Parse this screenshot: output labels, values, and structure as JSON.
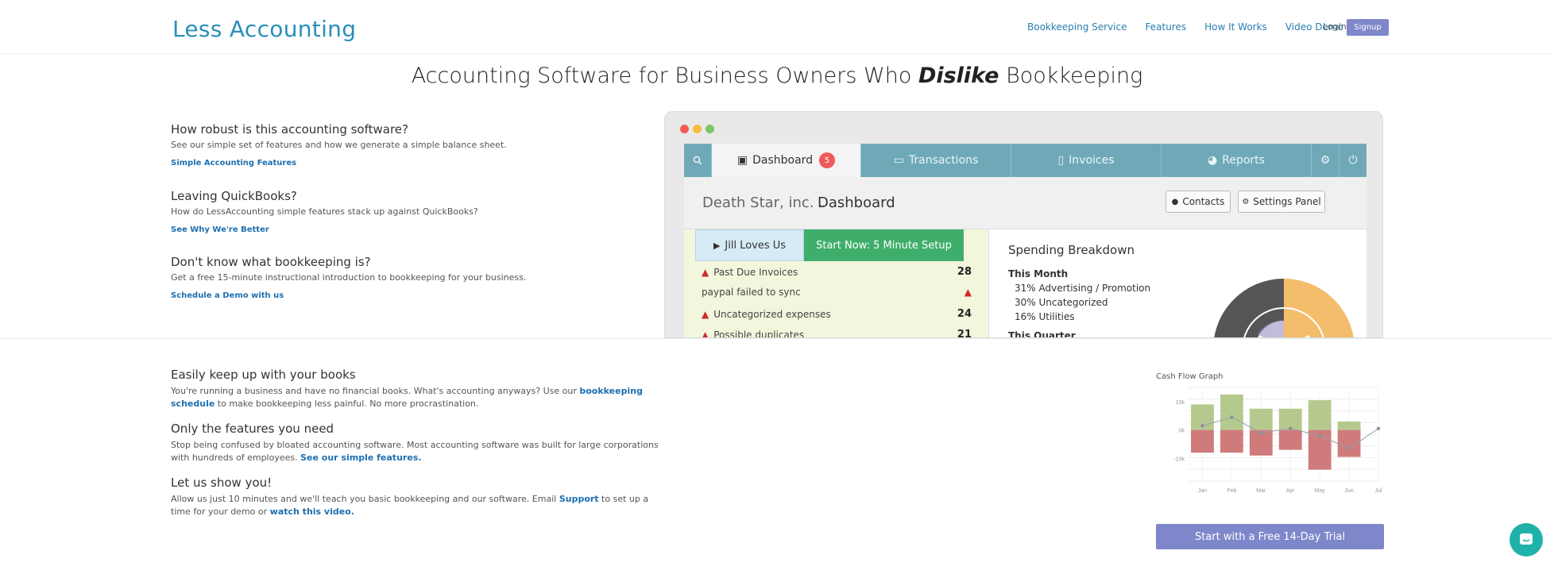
{
  "header": {
    "logo": "Less Accounting",
    "nav": [
      "Bookkeeping Service",
      "Features",
      "How It Works",
      "Video Demo"
    ],
    "login": "Login",
    "signup": "Signup"
  },
  "headline": {
    "before": "Accounting Software for Business Owners Who ",
    "emphasis": "Dislike",
    "after": " Bookkeeping"
  },
  "faq": [
    {
      "title": "How robust is this accounting software?",
      "text": "See our simple set of features and how we generate a simple balance sheet.",
      "link": "Simple Accounting Features"
    },
    {
      "title": "Leaving QuickBooks?",
      "text": "How do LessAccounting simple features stack up against QuickBooks?",
      "link": "See Why We're Better"
    },
    {
      "title": "Don't know what bookkeeping is?",
      "text": "Get a free 15-minute instructional introduction to bookkeeping for your business.",
      "link": "Schedule a Demo with us"
    }
  ],
  "app": {
    "tabs": {
      "dashboard": "Dashboard",
      "dashboard_badge": "5",
      "transactions": "Transactions",
      "invoices": "Invoices",
      "reports": "Reports"
    },
    "company": "Death Star, inc.",
    "page_title": "Dashboard",
    "contacts_btn": "Contacts",
    "settings_btn": "Settings Panel",
    "play_btn": "Jill Loves Us",
    "start_btn": "Start Now: 5 Minute Setup",
    "alerts": [
      {
        "label": "Past Due Invoices",
        "value": "28"
      },
      {
        "label": "paypal failed to sync",
        "value": ""
      },
      {
        "label": "Uncategorized expenses",
        "value": "24"
      },
      {
        "label": "Possible duplicates",
        "value": "21"
      }
    ],
    "spending_title": "Spending Breakdown",
    "this_month": "This Month",
    "spending": [
      "31% Advertising / Promotion",
      "30% Uncategorized",
      "16% Utilities"
    ],
    "this_quarter": "This Quarter"
  },
  "features": [
    {
      "title": "Easily keep up with your books",
      "text1": "You're running a business and have no financial books. What's accounting anyways? Use our ",
      "link": "bookkeeping schedule",
      "text2": " to make bookkeeping less painful. No more procrastination."
    },
    {
      "title": "Only the features you need",
      "text1": "Stop being confused by bloated accounting software. Most accounting software was built for large corporations with hundreds of employees. ",
      "link": "See our simple features.",
      "text2": ""
    },
    {
      "title": "Let us show you!",
      "text1": "Allow us just 10 minutes and we'll teach you basic bookkeeping and our software. Email ",
      "link": "Support",
      "text2": " to set up a time for your demo or ",
      "link2": "watch this video."
    }
  ],
  "cash_flow_title": "Cash Flow Graph",
  "trial_button": "Start with a Free 14-Day Trial",
  "chart_data": {
    "type": "bar",
    "title": "Cash Flow Graph",
    "categories": [
      "Jan",
      "Feb",
      "Mar",
      "Apr",
      "May",
      "Jun",
      "Jul"
    ],
    "series": [
      {
        "name": "",
        "values": [
          9,
          12.5,
          7.5,
          7.5,
          10.5,
          3,
          null
        ],
        "color": "#b5c98e"
      },
      {
        "name": "",
        "values": [
          -8,
          -8,
          -9,
          -7,
          -14,
          -9.5,
          null
        ],
        "color": "#cf7b7b"
      }
    ],
    "line": [
      1.5,
      4.5,
      -1,
      0.5,
      -2,
      -6.5,
      0.5
    ],
    "yticks": [
      "10k",
      "0k",
      "-10k"
    ],
    "ylim": [
      -18,
      15
    ]
  }
}
